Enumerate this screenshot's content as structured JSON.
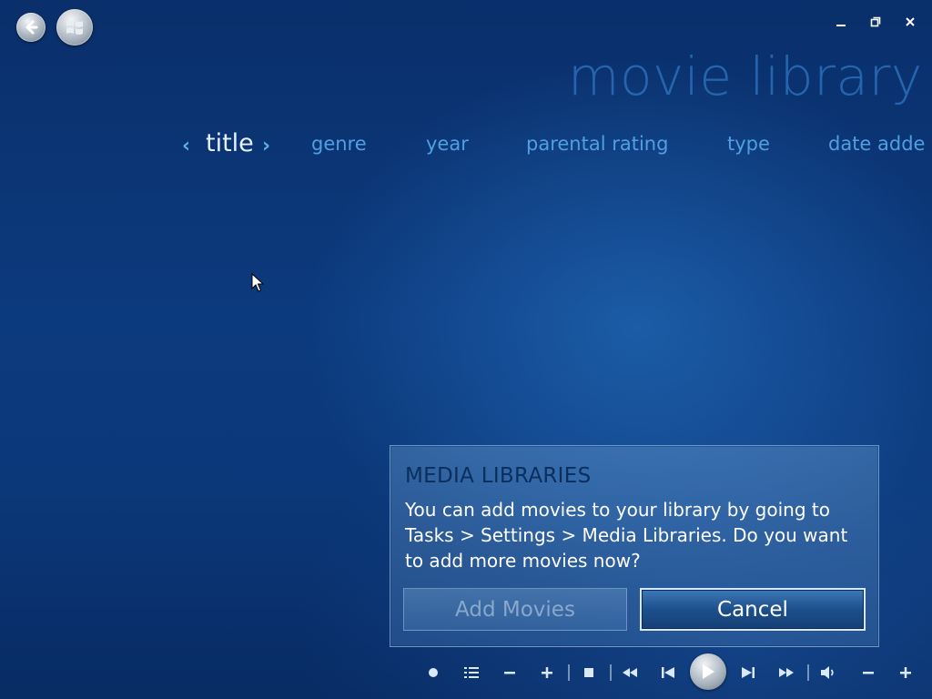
{
  "window": {
    "minimize_icon": "minimize-icon",
    "restore_icon": "restore-icon",
    "close_icon": "close-icon"
  },
  "header": {
    "title": "movie library",
    "back_icon": "back-arrow-icon",
    "start_icon": "windows-logo-icon"
  },
  "pivots": {
    "items": [
      {
        "label": "title",
        "active": true
      },
      {
        "label": "genre",
        "active": false
      },
      {
        "label": "year",
        "active": false
      },
      {
        "label": "parental rating",
        "active": false
      },
      {
        "label": "type",
        "active": false
      },
      {
        "label": "date adde",
        "active": false
      }
    ],
    "prev_arrow": "‹",
    "next_arrow": "›"
  },
  "dialog": {
    "title": "MEDIA LIBRARIES",
    "message": "You can add movies to your library by going to Tasks > Settings > Media Libraries. Do you want to add more movies now?",
    "add_button": "Add Movies",
    "cancel_button": "Cancel"
  },
  "transport": {
    "controls": [
      "record-icon",
      "guide-icon",
      "channel-down-icon",
      "channel-up-icon",
      "stop-icon",
      "rewind-icon",
      "skip-back-icon",
      "play-icon",
      "skip-forward-icon",
      "fast-forward-icon",
      "mute-icon",
      "volume-down-icon",
      "volume-up-icon"
    ]
  },
  "colors": {
    "accent": "#4fa0e2",
    "background": "#0c3a7e",
    "dialog_title": "#0a2e5e"
  }
}
